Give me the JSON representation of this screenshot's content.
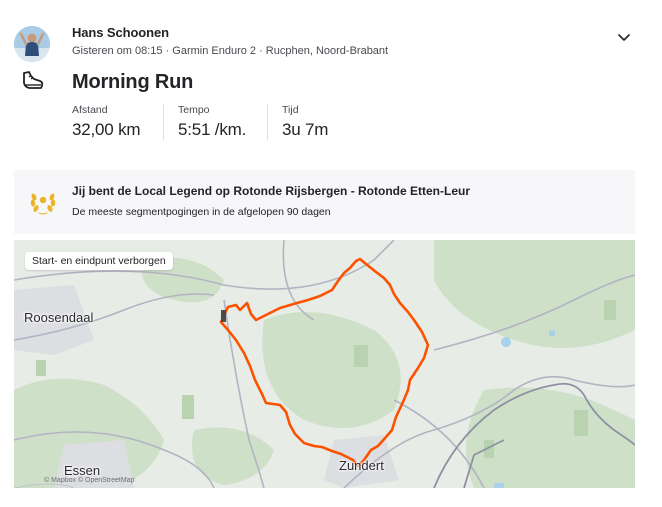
{
  "athlete": {
    "name": "Hans Schoonen",
    "meta": "Gisteren om 08:15 · Garmin Enduro 2 · Rucphen, Noord-Brabant"
  },
  "activity": {
    "sport_icon": "running-shoe-icon",
    "title": "Morning Run",
    "stats": [
      {
        "label": "Afstand",
        "value": "32,00 km"
      },
      {
        "label": "Tempo",
        "value": "5:51 /km."
      },
      {
        "label": "Tijd",
        "value": "3u 7m"
      }
    ]
  },
  "local_legend": {
    "icon": "laurel-wreath-icon",
    "title": "Jij bent de Local Legend op Rotonde Rijsbergen - Rotonde Etten-Leur",
    "subtitle": "De meeste segmentpogingen in de afgelopen 90 dagen"
  },
  "map": {
    "badge": "Start- en eindpunt verborgen",
    "places": [
      "Roosendaal",
      "Essen",
      "Zundert"
    ],
    "attribution": "© Mapbox © OpenStreetMap",
    "route_color": "#fc5200"
  },
  "colors": {
    "text": "#242428",
    "muted": "#494950",
    "legend_bg": "#f7f7fa",
    "accent": "#fc5200",
    "map_green": "#c9dcc3",
    "map_road": "#a7a7b8"
  }
}
